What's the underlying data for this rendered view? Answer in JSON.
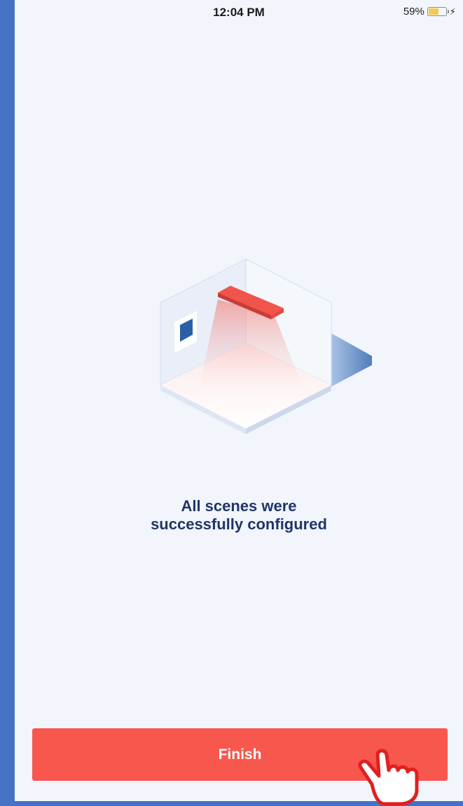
{
  "status_bar": {
    "time": "12:04 PM",
    "battery_percent_label": "59%",
    "battery_level": 0.59,
    "charging_icon": "bolt-icon"
  },
  "illustration": {
    "icon": "room-with-light-illustration",
    "colors": {
      "light_fixture": "#f0544a",
      "wall": "#e8eef8",
      "window": "#2a5fa6",
      "shadow": "#5a86c2"
    }
  },
  "message": {
    "line1": "All scenes were",
    "line2": "successfully configured"
  },
  "actions": {
    "finish_label": "Finish"
  },
  "colors": {
    "background": "#f2f5fc",
    "accent": "#f7574d",
    "text_primary": "#1f3668",
    "frame": "#4572c4"
  }
}
